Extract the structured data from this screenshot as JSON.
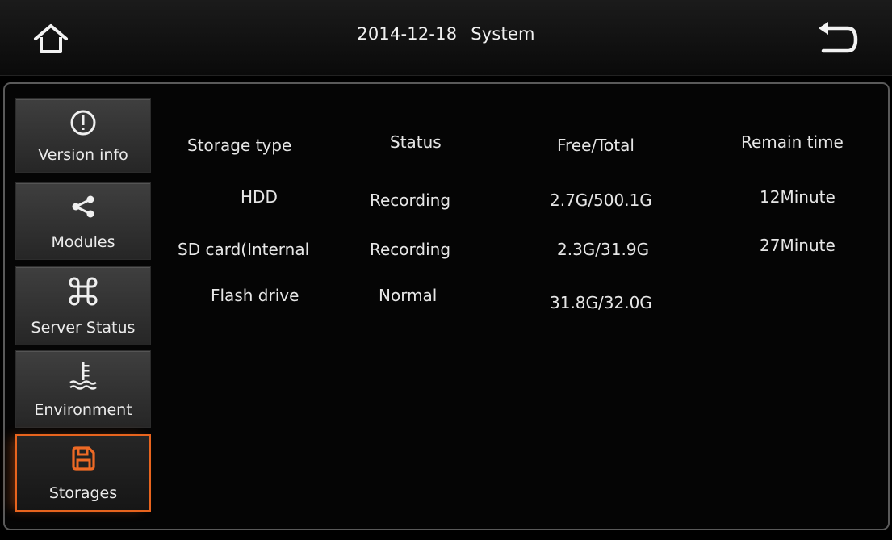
{
  "header": {
    "date": "2014-12-18",
    "title": "System",
    "home_icon": "home-icon",
    "back_icon": "back-arrow-icon"
  },
  "sidebar": {
    "items": [
      {
        "label": "Version info",
        "icon": "exclamation-circle-icon",
        "active": false
      },
      {
        "label": "Modules",
        "icon": "share-nodes-icon",
        "active": false
      },
      {
        "label": "Server Status",
        "icon": "command-key-icon",
        "active": false
      },
      {
        "label": "Environment",
        "icon": "thermometer-water-icon",
        "active": false
      },
      {
        "label": "Storages",
        "icon": "floppy-disk-icon",
        "active": true
      }
    ],
    "accent_color": "#e8641e"
  },
  "storage_table": {
    "headers": [
      "Storage type",
      "Status",
      "Free/Total",
      "Remain time"
    ],
    "rows": [
      {
        "type": "HDD",
        "status": "Recording",
        "free_total": "2.7G/500.1G",
        "remain": "12Minute"
      },
      {
        "type": "SD card(Internal",
        "status": "Recording",
        "free_total": "2.3G/31.9G",
        "remain": "27Minute"
      },
      {
        "type": "Flash drive",
        "status": "Normal",
        "free_total": "31.8G/32.0G",
        "remain": ""
      }
    ]
  }
}
